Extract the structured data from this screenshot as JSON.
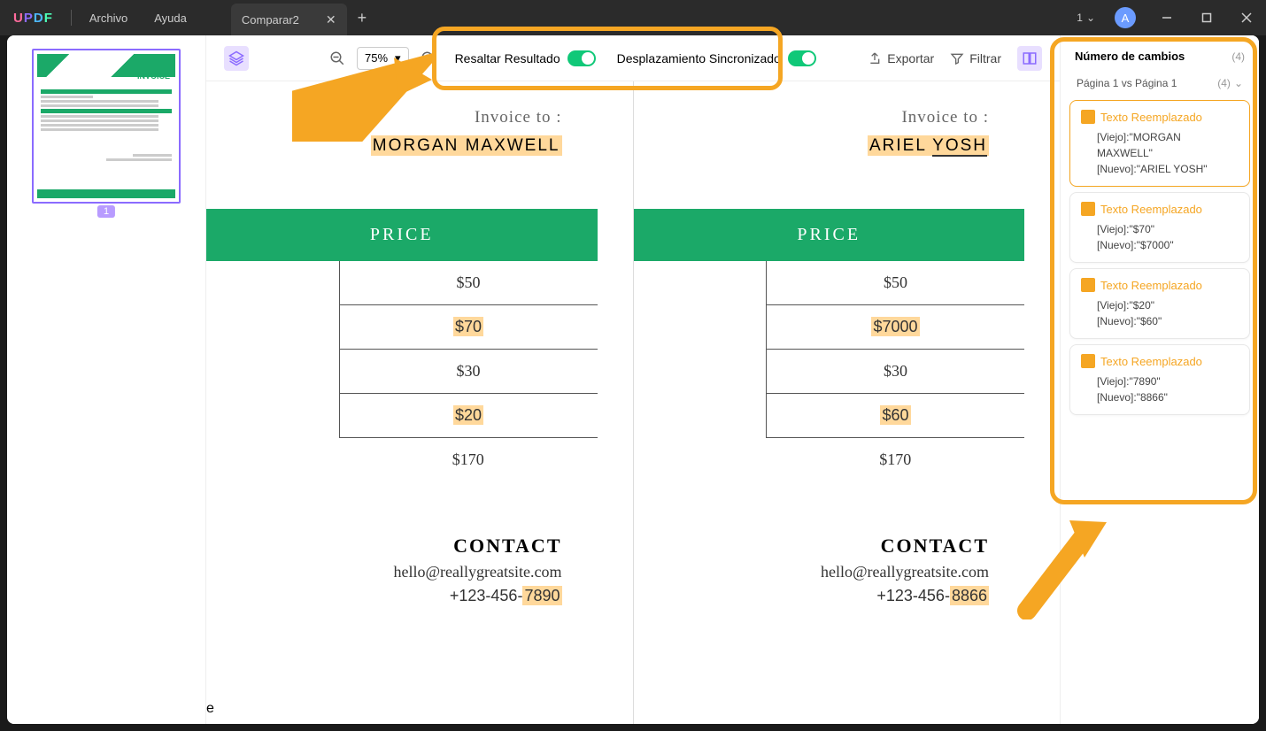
{
  "titlebar": {
    "menu_file": "Archivo",
    "menu_help": "Ayuda",
    "tab_name": "Comparar2",
    "page_indicator": "1",
    "avatar_letter": "A"
  },
  "toolbar": {
    "zoom": "75%",
    "toggle_highlight": "Resaltar Resultado",
    "toggle_sync": "Desplazamiento Sincronizado",
    "export": "Exportar",
    "filter": "Filtrar"
  },
  "thumb": {
    "page_num": "1",
    "header_text": "INVOICE"
  },
  "doc_left": {
    "invoice_to": "Invoice to :",
    "name": "MORGAN MAXWELL",
    "price_header": "PRICE",
    "rows": [
      "$50",
      "$70",
      "$30",
      "$20",
      "$170"
    ],
    "highlighted_rows": [
      1,
      3
    ],
    "contact_title": "CONTACT",
    "email": "hello@reallygreatsite.com",
    "phone_prefix": "+123-456-",
    "phone_suffix": "7890",
    "left_edge": "e"
  },
  "doc_right": {
    "invoice_to": "Invoice to :",
    "name_pre": "ARIEL ",
    "name_hl": "YOSH",
    "price_header": "PRICE",
    "rows": [
      "$50",
      "$7000",
      "$30",
      "$60",
      "$170"
    ],
    "highlighted_rows": [
      1,
      3
    ],
    "contact_title": "CONTACT",
    "email": "hello@reallygreatsite.com",
    "phone_prefix": "+123-456-",
    "phone_suffix": "8866"
  },
  "changes": {
    "title": "Número de cambios",
    "count": "(4)",
    "page_vs": "Página 1 vs Página 1",
    "page_vs_count": "(4)",
    "items": [
      {
        "title": "Texto Reemplazado",
        "old": "[Viejo]:\"MORGAN MAXWELL\"",
        "new": "[Nuevo]:\"ARIEL YOSH\""
      },
      {
        "title": "Texto Reemplazado",
        "old": "[Viejo]:\"$70\"",
        "new": "[Nuevo]:\"$7000\""
      },
      {
        "title": "Texto Reemplazado",
        "old": "[Viejo]:\"$20\"",
        "new": "[Nuevo]:\"$60\""
      },
      {
        "title": "Texto Reemplazado",
        "old": "[Viejo]:\"7890\"",
        "new": "[Nuevo]:\"8866\""
      }
    ]
  }
}
